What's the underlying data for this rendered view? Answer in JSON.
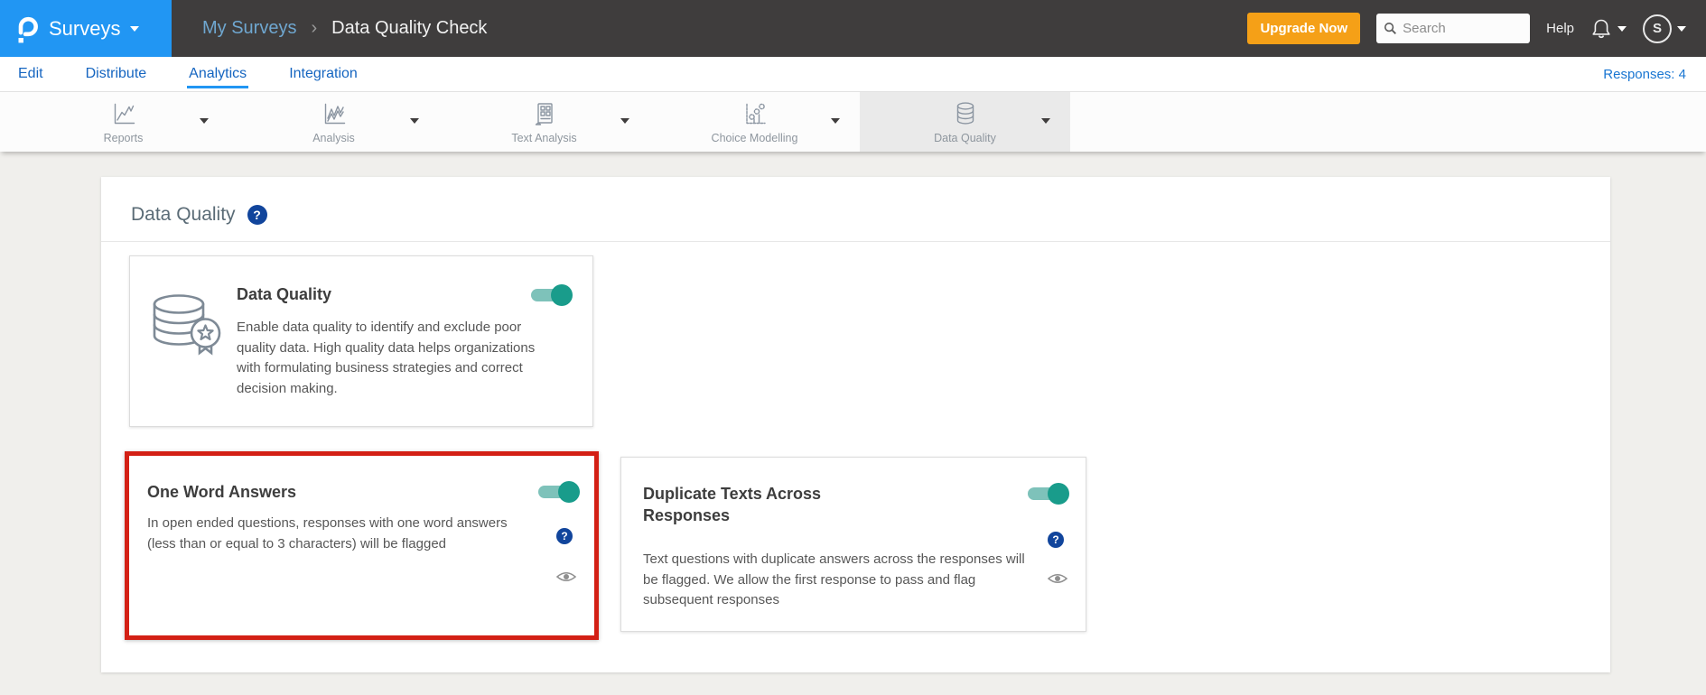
{
  "header": {
    "product": "Surveys",
    "breadcrumb": {
      "parent": "My Surveys",
      "separator": "›",
      "current": "Data Quality Check"
    },
    "upgrade_label": "Upgrade Now",
    "search_placeholder": "Search",
    "help_label": "Help",
    "avatar_initial": "S"
  },
  "nav": {
    "items": [
      {
        "label": "Edit"
      },
      {
        "label": "Distribute"
      },
      {
        "label": "Analytics"
      },
      {
        "label": "Integration"
      }
    ],
    "active_item": "Analytics",
    "responses_label": "Responses: 4"
  },
  "toolbar": {
    "tabs": [
      {
        "label": "Reports",
        "icon": "line-chart-icon"
      },
      {
        "label": "Analysis",
        "icon": "multi-line-chart-icon"
      },
      {
        "label": "Text Analysis",
        "icon": "document-icon"
      },
      {
        "label": "Choice Modelling",
        "icon": "bubble-chart-icon"
      },
      {
        "label": "Data Quality",
        "icon": "database-icon",
        "active": true
      }
    ]
  },
  "main": {
    "title": "Data Quality",
    "help_glyph": "?",
    "cards": {
      "data_quality": {
        "title": "Data Quality",
        "toggle": "on",
        "description": "Enable data quality to identify and exclude poor quality data. High quality data helps organizations with formulating business strategies and correct decision making."
      },
      "one_word": {
        "title": "One Word Answers",
        "toggle": "on",
        "highlighted": true,
        "description": "In open ended questions, responses with one word answers (less than or equal to 3 characters) will be flagged"
      },
      "duplicate_texts": {
        "title": "Duplicate Texts Across Responses",
        "toggle": "on",
        "description": "Text questions with duplicate answers across the responses will be flagged. We allow the first response to pass and flag subsequent responses"
      }
    }
  },
  "colors": {
    "brand_blue": "#2196F3",
    "header_charcoal": "#3F3D3D",
    "upgrade_orange": "#F5A017",
    "link_blue": "#1565C0",
    "toggle_teal": "#199C8B",
    "toggle_track_teal": "#7EC2BA",
    "highlight_red": "#D32015",
    "help_badge_blue": "#11459C"
  }
}
